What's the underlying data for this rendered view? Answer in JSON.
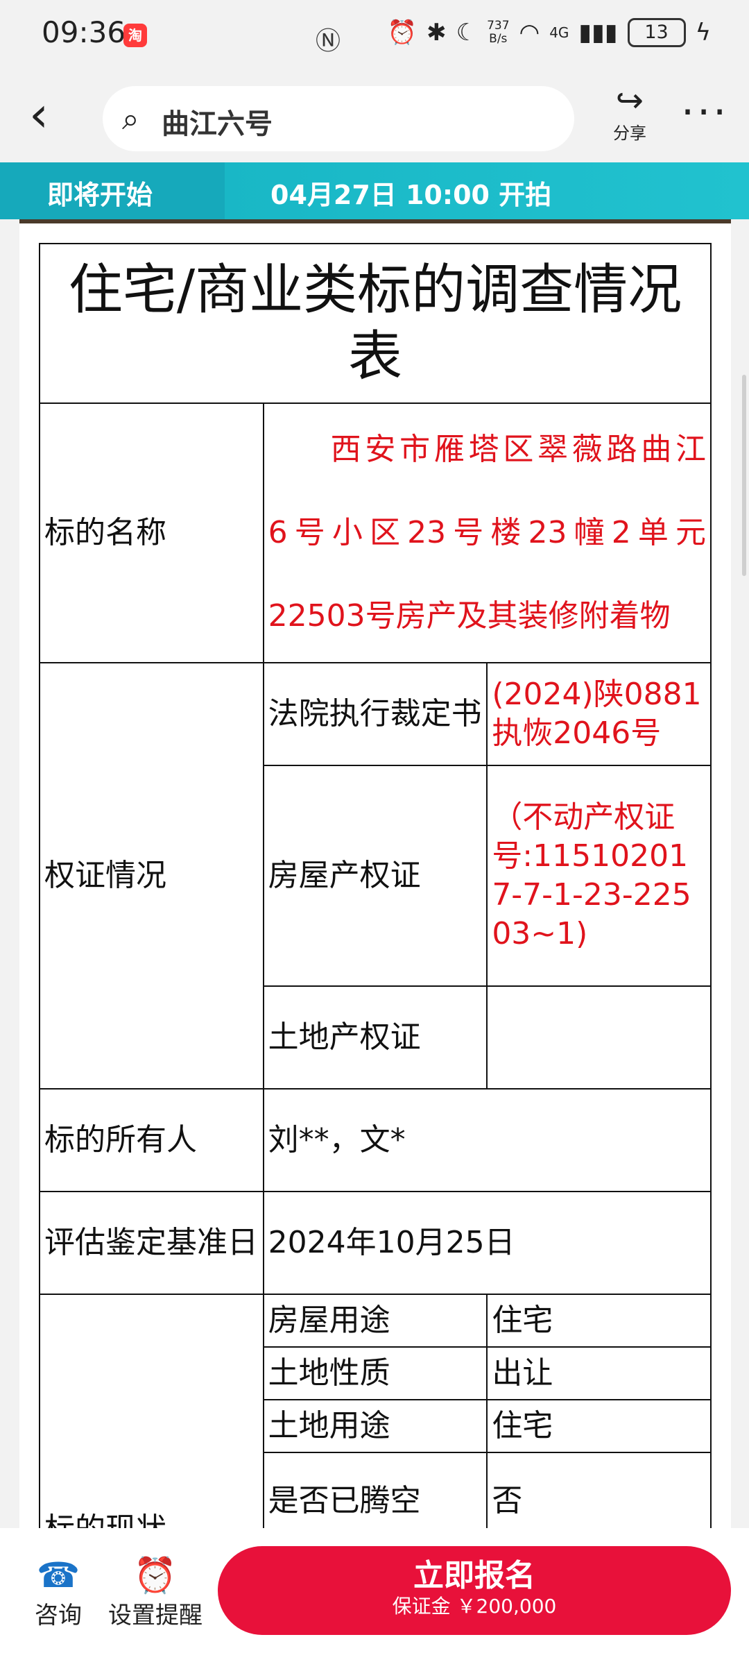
{
  "status_bar": {
    "time": "09:36",
    "app_icon": "淘",
    "speed_value": "737",
    "speed_unit": "B/s",
    "network": "4G",
    "battery": "13"
  },
  "header": {
    "search_query": "曲江六号",
    "share_label": "分享"
  },
  "auction_bar": {
    "status": "即将开始",
    "start_time": "04月27日 10:00 开拍"
  },
  "document": {
    "title": "住宅/商业类标的调查情况表",
    "rows": {
      "name_label": "标的名称",
      "name_lines": [
        "西安市雁塔区翠薇路曲江",
        "6号小区23号楼23幢2单元",
        "22503号房产及其装修附着物"
      ],
      "rights_label": "权证情况",
      "court_label": "法院执行裁定书",
      "court_value": "(2024)陕0881执恢2046号",
      "house_cert_label": "房屋产权证",
      "house_cert_value": "（不动产权证号:115102017-7-1-23-22503~1)",
      "land_cert_label": "土地产权证",
      "land_cert_value": "",
      "owner_label": "标的所有人",
      "owner_value": "刘**，文*",
      "appraisal_label": "评估鉴定基准日",
      "appraisal_value": "2024年10月25日",
      "status_label": "标的现状",
      "usage_label": "房屋用途",
      "usage_value": "住宅",
      "land_nature_label": "土地性质",
      "land_nature_value": "出让",
      "land_use_label": "土地用途",
      "land_use_value": "住宅",
      "vacated_label": "是否已腾空",
      "vacated_value": "否"
    }
  },
  "bottom_bar": {
    "consult_label": "咨询",
    "reminder_label": "设置提醒",
    "signup_label": "立即报名",
    "deposit_text": "保证金 ￥200,000"
  },
  "colors": {
    "accent_teal": "#16a9bb",
    "signup_red": "#e8113a",
    "text_red": "#e0131c"
  }
}
